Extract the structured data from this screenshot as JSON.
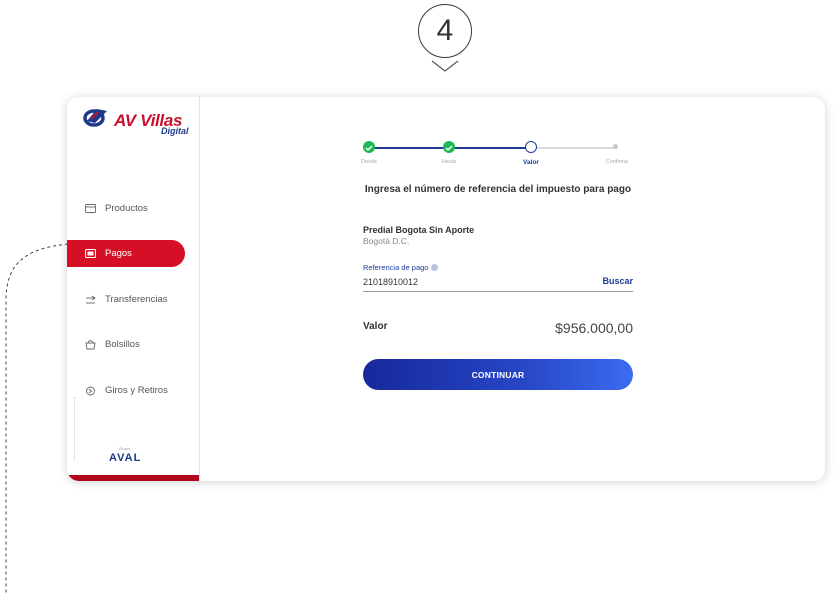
{
  "step_number": "4",
  "brand": {
    "name": "AV Villas",
    "subtitle": "Digital",
    "footer_logo": "AVAL",
    "footer_small": "Grupo"
  },
  "sidebar": {
    "items": [
      {
        "label": "Productos",
        "icon": "card-icon"
      },
      {
        "label": "Pagos",
        "icon": "payment-icon",
        "active": true
      },
      {
        "label": "Transferencias",
        "icon": "transfer-icon"
      },
      {
        "label": "Bolsillos",
        "icon": "pocket-icon"
      },
      {
        "label": "Giros y Retiros",
        "icon": "withdraw-icon"
      }
    ]
  },
  "stepper": {
    "steps": [
      {
        "label": "Desde",
        "state": "done"
      },
      {
        "label": "Hasta",
        "state": "done"
      },
      {
        "label": "Valor",
        "state": "current"
      },
      {
        "label": "Confirma",
        "state": "pending"
      }
    ]
  },
  "form": {
    "heading": "Ingresa el número de referencia del impuesto para pago",
    "tax_name": "Predial Bogota Sin Aporte",
    "tax_city": "Bogotá D.C.",
    "reference_label": "Referencia de pago",
    "reference_value": "21018910012",
    "search_label": "Buscar",
    "valor_label": "Valor",
    "valor_amount": "$956.000,00",
    "continue_label": "CONTINUAR"
  },
  "colors": {
    "brand_red": "#d50f25",
    "brand_blue": "#1e3d9b",
    "success_green": "#1db954"
  }
}
